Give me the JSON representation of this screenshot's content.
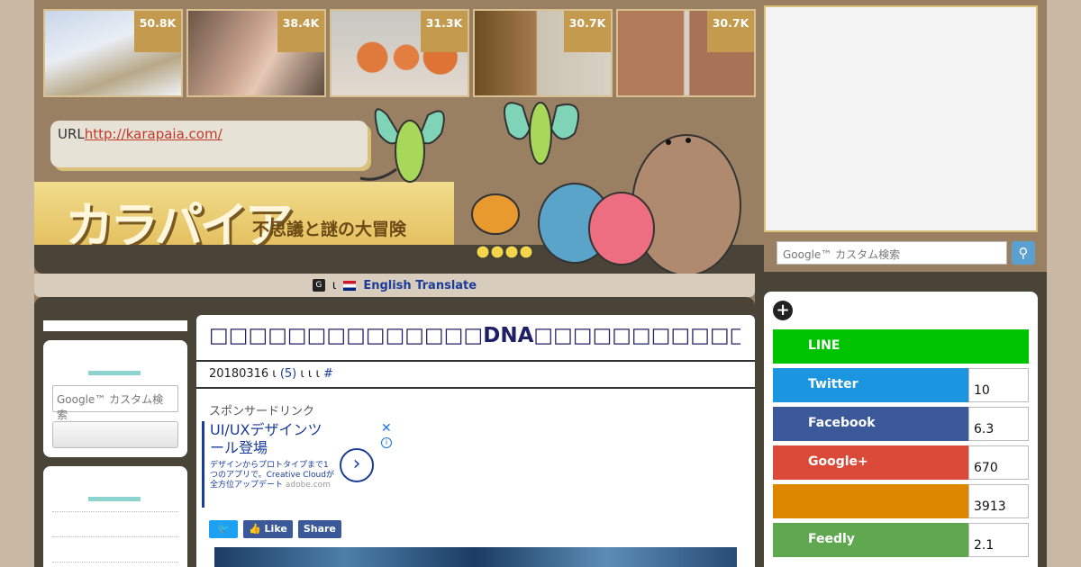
{
  "header": {
    "thumbs": [
      {
        "count": "50.8K"
      },
      {
        "count": "38.4K"
      },
      {
        "count": "31.3K"
      },
      {
        "count": "30.7K"
      },
      {
        "count": "30.7K"
      }
    ],
    "url_label": "URL",
    "url": "http://karapaia.com/",
    "logo_main": "カラパイア",
    "logo_sub": "不思議と謎の大冒険"
  },
  "translate": {
    "separator": "ι",
    "label": "English Translate"
  },
  "left_sidebar": {
    "search_placeholder": "Google™ カスタム検索"
  },
  "article": {
    "title": "□□□□□□□□□□□□□□DNA□□□□□□□□□□□□□□□□□□NASA□",
    "date": "20180316",
    "sep1": " ι ",
    "comments": "(5)",
    "sep2": " ι ι ι ",
    "hash": "#",
    "sponsor": "スポンサードリンク",
    "ad": {
      "headline": "UI/UXデザインツール登場",
      "body": "デザインからプロトタイプまで1つのアプリで。Creative Cloudが全方位アップデート",
      "domain": "adobe.com"
    },
    "share": {
      "like": "Like",
      "share": "Share"
    }
  },
  "right_sidebar": {
    "search_placeholder": "Google™ カスタム検索",
    "social": [
      {
        "name": "LINE",
        "count": "",
        "color": "#00c300"
      },
      {
        "name": "Twitter",
        "count": "10",
        "color": "#1b95e0"
      },
      {
        "name": "Facebook",
        "count": "6.3",
        "color": "#3b5998"
      },
      {
        "name": "Google+",
        "count": "670",
        "color": "#db4a39"
      },
      {
        "name": "",
        "count": "3913",
        "color": "#dd8600"
      },
      {
        "name": "Feedly",
        "count": "2.1",
        "color": "#5fa84f"
      }
    ]
  }
}
